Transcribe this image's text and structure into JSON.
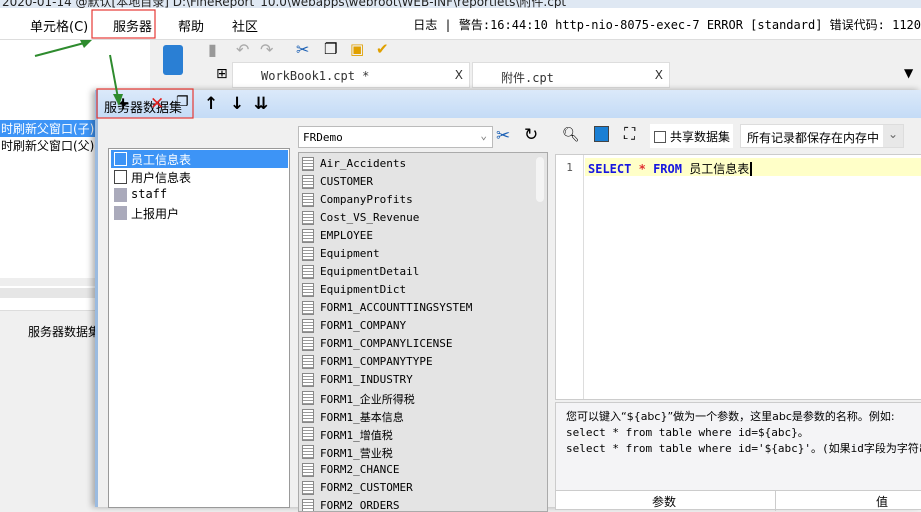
{
  "titlebar": {
    "text": "2020-01-14 @默认[本地目录]     D:\\FineReport_10.0\\webapps\\webroot\\WEB-INF\\reportlets\\附件.cpt"
  },
  "menu": [
    "单元格(C)",
    "服务器",
    "帮助",
    "社区"
  ],
  "log": "日志 | 警告:16:44:10 http-nio-8075-exec-7 ERROR [standard] 错误代码: 1120",
  "left_panel": {
    "rows": [
      "时刷新父窗口(子)",
      "时刷新父窗口(父)"
    ],
    "footer": "服务器数据集"
  },
  "tabs": [
    {
      "label": "WorkBook1.cpt *"
    },
    {
      "label": "附件.cpt"
    }
  ],
  "dialog": {
    "title": "服务器数据集",
    "datasets": [
      {
        "label": "员工信息表",
        "selected": true
      },
      {
        "label": "用户信息表"
      },
      {
        "label": "staff"
      },
      {
        "label": "上报用户"
      }
    ],
    "connection": "FRDemo",
    "tables": [
      "Air_Accidents",
      "CUSTOMER",
      "CompanyProfits",
      "Cost_VS_Revenue",
      "EMPLOYEE",
      "Equipment",
      "EquipmentDetail",
      "EquipmentDict",
      "FORM1_ACCOUNTTINGSYSTEM",
      "FORM1_COMPANY",
      "FORM1_COMPANYLICENSE",
      "FORM1_COMPANYTYPE",
      "FORM1_INDUSTRY",
      "FORM1_企业所得税",
      "FORM1_基本信息",
      "FORM1_增值税",
      "FORM1_营业税",
      "FORM2_CHANCE",
      "FORM2_CUSTOMER",
      "FORM2_ORDERS"
    ],
    "share_label": "共享数据集",
    "storage_option": "所有记录都保存在内存中",
    "sql": {
      "line": "1",
      "kw1": "SELECT",
      "star": "*",
      "kw2": "FROM",
      "table": "员工信息表"
    },
    "info": [
      "您可以键入“${abc}”做为一个参数，这里abc是参数的名称。例如:",
      "select * from table where id=${abc}。",
      "select * from table where id='${abc}'。(如果id字段为字符串类"
    ],
    "param_header": {
      "param": "参数",
      "value": "值"
    }
  },
  "colors": {
    "accent": "#3d94f6",
    "highlight": "#ffffc8",
    "annotation_red": "#e53935",
    "arrow_green": "#2e8b2e"
  }
}
